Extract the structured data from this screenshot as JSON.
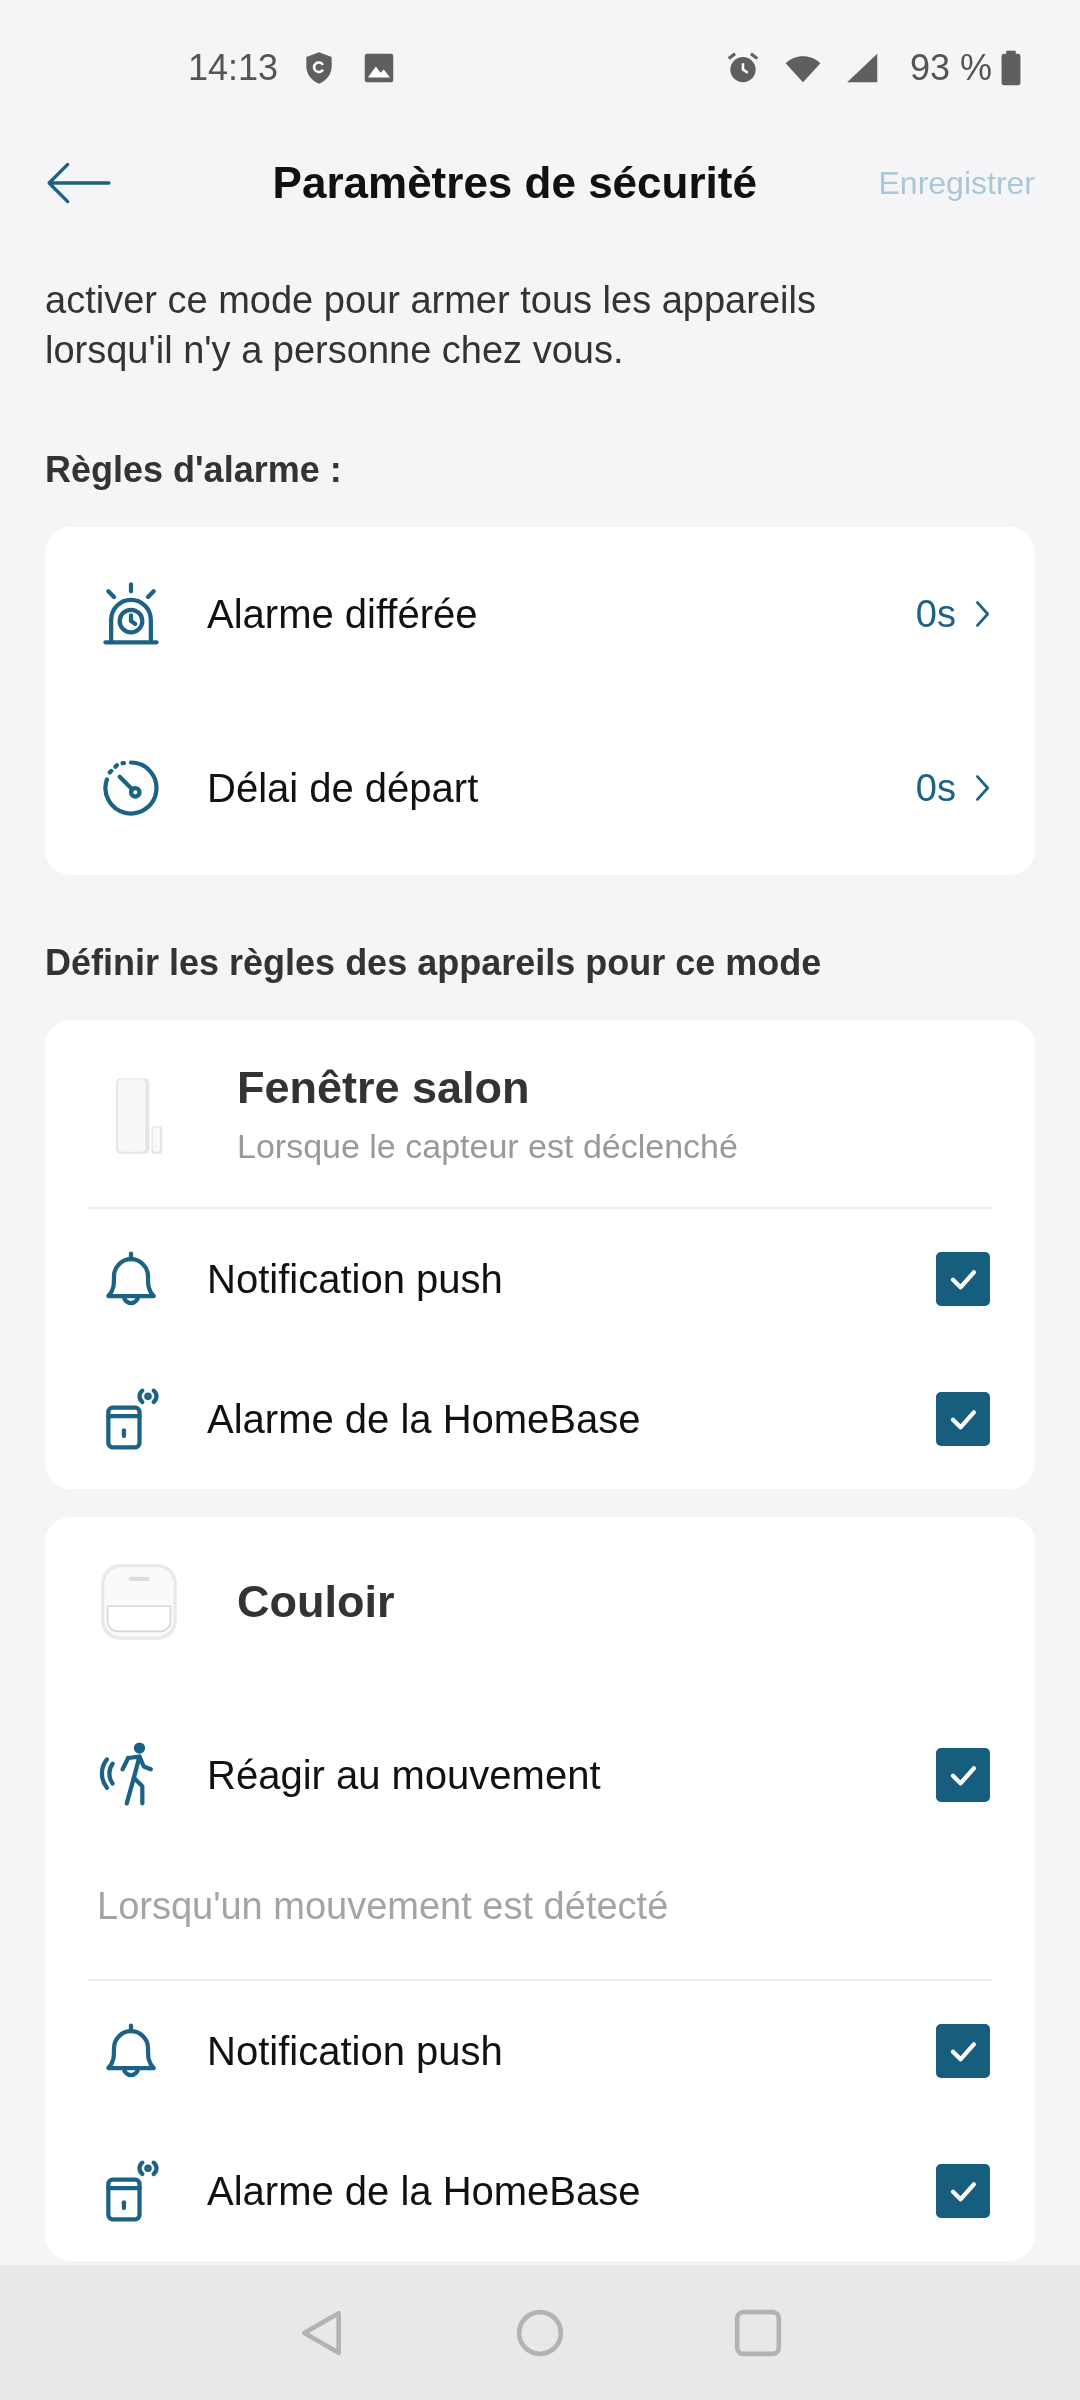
{
  "status_bar": {
    "time": "14:13",
    "battery": "93 %"
  },
  "header": {
    "title": "Paramètres de sécurité",
    "action": "Enregistrer",
    "action_disabled": true
  },
  "intro": "activer ce mode pour armer tous les appareils lorsqu'il n'y a personne chez vous.",
  "alarm_rules": {
    "heading": "Règles d'alarme :",
    "items": [
      {
        "kind": "siren",
        "label": "Alarme différée",
        "value": "0s"
      },
      {
        "kind": "timer",
        "label": "Délai de départ",
        "value": "0s"
      }
    ]
  },
  "device_rules": {
    "heading": "Définir les règles des appareils pour ce mode",
    "devices": [
      {
        "name": "Fenêtre salon",
        "trigger": "Lorsque le capteur est déclenché",
        "rules": [
          {
            "kind": "bell",
            "label": "Notification push",
            "checked": true
          },
          {
            "kind": "homebase",
            "label": "Alarme de la HomeBase",
            "checked": true
          }
        ]
      },
      {
        "name": "Couloir",
        "motion": {
          "label": "Réagir au mouvement",
          "checked": true
        },
        "trigger": "Lorsqu'un mouvement est détecté",
        "rules": [
          {
            "kind": "bell",
            "label": "Notification push",
            "checked": true
          },
          {
            "kind": "homebase",
            "label": "Alarme de la HomeBase",
            "checked": true
          }
        ]
      }
    ]
  }
}
